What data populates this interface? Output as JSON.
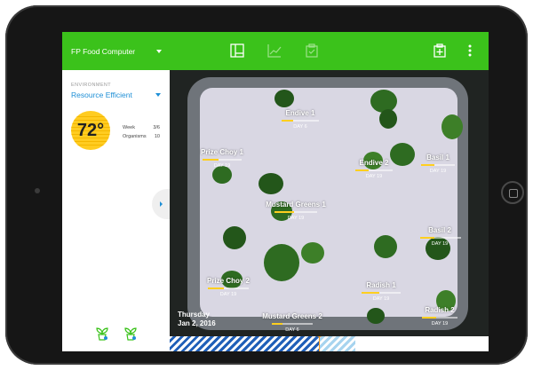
{
  "app": {
    "title": "FP Food Computer"
  },
  "sidebar": {
    "environment_label": "ENVIRONMENT",
    "environment_value": "Resource Efficient",
    "temperature": "72°",
    "stats": {
      "week_label": "Week",
      "week_value": "3/6",
      "organisms_label": "Organisms",
      "organisms_value": "10"
    }
  },
  "topbar": {
    "icons": [
      "layout-icon",
      "line-chart-icon",
      "clipboard-check-icon",
      "clipboard-add-icon",
      "more-vertical-icon"
    ]
  },
  "plants": [
    {
      "name": "Endive 1",
      "day": "DAY 6",
      "progress": 0.3
    },
    {
      "name": "Basil 1",
      "day": "DAY 19",
      "progress": 0.4
    },
    {
      "name": "Prize Choy 1",
      "day": "DAY 19",
      "progress": 0.4
    },
    {
      "name": "Endive 2",
      "day": "DAY 19",
      "progress": 0.35
    },
    {
      "name": "Mustard Greens 1",
      "day": "DAY 19",
      "progress": 0.45
    },
    {
      "name": "Basil 2",
      "day": "DAY 19",
      "progress": 0.35
    },
    {
      "name": "Prize Choy 2",
      "day": "DAY 19",
      "progress": 0.4
    },
    {
      "name": "Radish 1",
      "day": "DAY 19",
      "progress": 0.45
    },
    {
      "name": "Radish 2",
      "day": "DAY 19",
      "progress": 0.4
    },
    {
      "name": "Mustard Greens 2",
      "day": "DAY 6",
      "progress": 0.25
    }
  ],
  "date": {
    "weekday": "Thursday",
    "date": "Jan 2, 2016"
  },
  "timeline": {
    "progress_fraction": 0.47
  },
  "colors": {
    "accent_green": "#3bc21b",
    "accent_blue": "#1e8fd6",
    "temp_yellow": "#ffcc21",
    "progress_yellow": "#ffcf1f",
    "timeline_orange": "#f29a24"
  }
}
